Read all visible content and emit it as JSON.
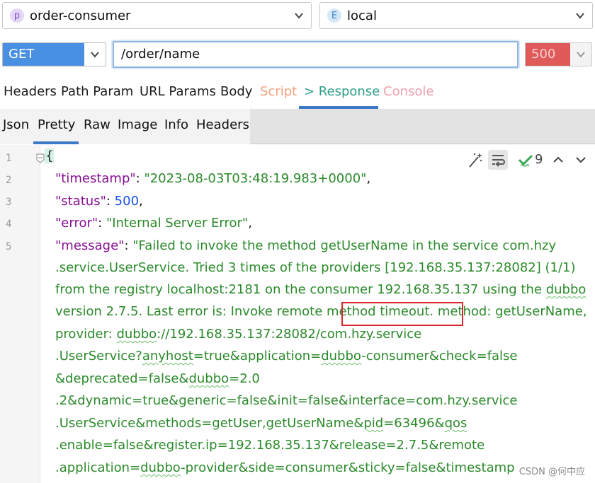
{
  "project_select": {
    "badge": "p",
    "value": "order-consumer"
  },
  "env_select": {
    "badge": "E",
    "value": "local"
  },
  "request": {
    "method": "GET",
    "url": "/order/name",
    "status": "500"
  },
  "request_tabs": [
    "Headers",
    "Path Param",
    "URL Params",
    "Body",
    "Script",
    "> Response",
    "Console"
  ],
  "response_tabs": [
    "Json",
    "Pretty",
    "Raw",
    "Image",
    "Info",
    "Headers"
  ],
  "editor": {
    "line_numbers": [
      "1",
      "2",
      "3",
      "4",
      "5"
    ],
    "open_brace": "{",
    "toolbar": {
      "match_count": "9"
    },
    "lines": {
      "timestamp_key": "\"timestamp\"",
      "timestamp_val": "\"2023-08-03T03:48:19.983+0000\"",
      "status_key": "\"status\"",
      "status_val": "500",
      "error_key": "\"error\"",
      "error_val": "\"Internal Server Error\"",
      "message_key": "\"message\"",
      "m1": "\"Failed to invoke the method getUserName in the service com.hzy",
      "m2": ".service.UserService. Tried 3 times of the providers [192.168.35.137:28082] (1/1)",
      "m3a": "from the registry localhost:2181 on the consumer 192.168.35.137 using the ",
      "m3b": "dubbo",
      "m4": "version 2.7.5. Last error is: Invoke remote method timeout. method: getUserName,",
      "m5a": "provider: ",
      "m5b": "dubbo",
      "m5c": "://192.168.35.137:28082/com.hzy.service",
      "m6a": ".UserService?",
      "m6b": "anyhost",
      "m6c": "=true&application=",
      "m6d": "dubbo",
      "m6e": "-consumer&check=false",
      "m7a": "&deprecated=false&",
      "m7b": "dubbo",
      "m7c": "=2.0",
      "m8": ".2&dynamic=true&generic=false&init=false&interface=com.hzy.service",
      "m9a": ".UserService&methods=getUser,getUserName&",
      "m9b": "pid",
      "m9c": "=63496&",
      "m9d": "qos",
      "m10": ".enable=false&register.ip=192.168.35.137&release=2.7.5&remote",
      "m11a": ".application=",
      "m11b": "dubbo",
      "m11c": "-provider&side=consumer&sticky=false&timestamp"
    }
  },
  "watermark": "CSDN @何中应",
  "colors": {
    "accent": "#3c79c6",
    "method_bg": "#4a90e2",
    "status_bg": "#e05a5a",
    "key": "#871094",
    "string": "#2b8a2b",
    "number": "#1750eb",
    "highlight_box": "#d9272e"
  }
}
